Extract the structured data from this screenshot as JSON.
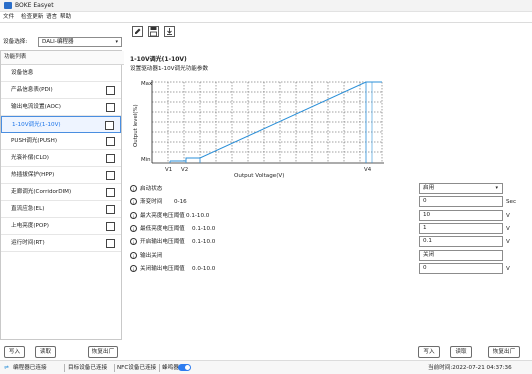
{
  "app": {
    "title": "BOKE Easyet"
  },
  "menu": {
    "items": [
      "文件",
      "检查更新",
      "语言",
      "帮助"
    ]
  },
  "device": {
    "label": "设备选择:",
    "value": "DALI-编程器"
  },
  "sidebar": {
    "header": "功能列表",
    "items": [
      {
        "label": "设备信息",
        "has_checkbox": false
      },
      {
        "label": "产品信息表(PDI)",
        "has_checkbox": true
      },
      {
        "label": "输出电流设置(AOC)",
        "has_checkbox": true
      },
      {
        "label": "1-10V调光(1-10V)",
        "has_checkbox": true,
        "active": true
      },
      {
        "label": "PUSH调光(PUSH)",
        "has_checkbox": true
      },
      {
        "label": "光衰补偿(CLO)",
        "has_checkbox": true
      },
      {
        "label": "热插拔保护(HPP)",
        "has_checkbox": true
      },
      {
        "label": "走廊调光(CorridorDIM)",
        "has_checkbox": true
      },
      {
        "label": "直流应急(EL)",
        "has_checkbox": true
      },
      {
        "label": "上电亮度(POP)",
        "has_checkbox": true
      },
      {
        "label": "运行时间(RT)",
        "has_checkbox": true
      }
    ]
  },
  "left_buttons": {
    "write": "写入",
    "read": "读取",
    "reset": "恢复出厂"
  },
  "main": {
    "title": "1-10V调光(1-10V)",
    "subtitle": "设置驱动器1-10V调光功能参数",
    "chart": {
      "ylabel": "Output level(%)",
      "xlabel": "Output Voltage(V)",
      "y_ticks": [
        "Max",
        "Min"
      ],
      "x_ticks": [
        "V1",
        "V2",
        "V4"
      ]
    },
    "params": [
      {
        "label": "启动状态",
        "range": "",
        "value": "启用",
        "unit": "",
        "type": "select"
      },
      {
        "label": "渐变时间",
        "range": "0-16",
        "value": "0",
        "unit": "Sec",
        "type": "input"
      },
      {
        "label": "最大亮度电压阈值",
        "range": "0.1-10.0",
        "value": "10",
        "unit": "V",
        "type": "input"
      },
      {
        "label": "最低亮度电压阈值",
        "range": "0.1-10.0",
        "value": "1",
        "unit": "V",
        "type": "input"
      },
      {
        "label": "开启输出电压阈值",
        "range": "0.1-10.0",
        "value": "0.1",
        "unit": "V",
        "type": "input"
      },
      {
        "label": "输出关闭",
        "range": "",
        "value": "关闭",
        "unit": "",
        "type": "input"
      },
      {
        "label": "关闭输出电压阈值",
        "range": "0.0-10.0",
        "value": "0",
        "unit": "V",
        "type": "input"
      }
    ]
  },
  "right_buttons": {
    "write": "写入",
    "read": "读取",
    "reset": "恢复出厂"
  },
  "status": {
    "programmer": "编程器已连接",
    "target": "目标设备已连接",
    "nfc": "NFC设备已连接",
    "buzzer": "蜂鸣器",
    "time": "当前时间:2022-07-21 04:37:36"
  },
  "colors": {
    "accent": "#1a73e8",
    "chart_line": "#2a8fd8",
    "grid": "#333333"
  },
  "icons": {
    "tb1": "edit-icon",
    "tb2": "save-icon",
    "tb3": "download-icon"
  }
}
